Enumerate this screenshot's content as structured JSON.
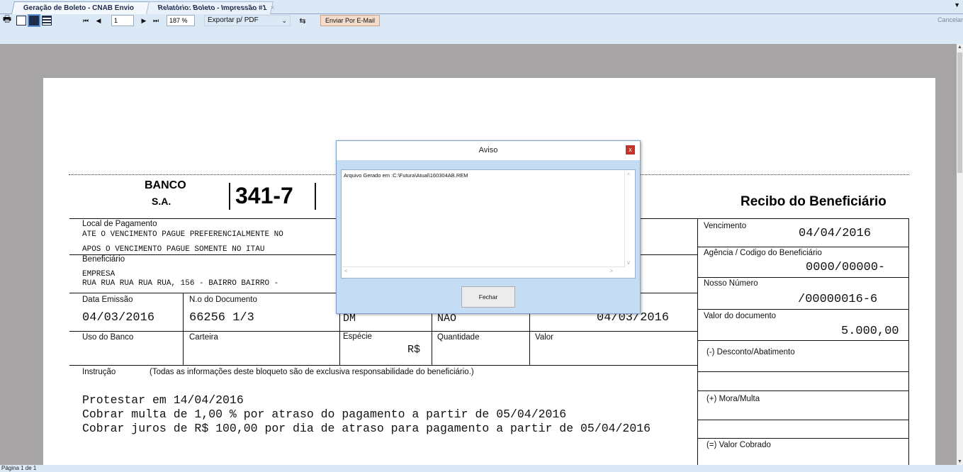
{
  "tabs": [
    {
      "label": "Geração de Boleto - CNAB Envio"
    },
    {
      "label": "Relatório: Boleto - Impressão #1",
      "close": "×"
    }
  ],
  "toolbar": {
    "page_value": "1",
    "zoom": "187 %",
    "export_selected": "Exportar p/ PDF",
    "email_button": "Enviar Por E-Mail",
    "cancel_label": "Cancelar",
    "icons": [
      "printer-icon",
      "single-page-icon",
      "double-page-icon",
      "multi-page-icon",
      "first-page-icon",
      "prev-page-icon",
      "next-page-icon",
      "last-page-icon",
      "export-icon"
    ]
  },
  "boleto": {
    "bank_name_1": "BANCO",
    "bank_name_2": "S.A.",
    "bank_code": "341-7",
    "receipt_title": "Recibo do Beneficiário",
    "local_pagamento_label": "Local de Pagamento",
    "local_line_1": "ATE O VENCIMENTO PAGUE PREFERENCIALMENTE NO",
    "local_line_2": "APOS O VENCIMENTO PAGUE SOMENTE NO ITAU",
    "beneficiario_label": "Beneficiário",
    "beneficiario_name": "EMPRESA",
    "beneficiario_address": "RUA RUA RUA RUA RUA, 156 - BAIRRO BAIRRO -",
    "data_emissao_label": "Data Emissão",
    "data_emissao": "04/03/2016",
    "num_documento_label": "N.o do Documento",
    "num_documento": "66256 1/3",
    "especie_doc": "DM",
    "aceite": "NAO",
    "data_processamento": "04/03/2016",
    "uso_banco_label": "Uso do Banco",
    "carteira_label": "Carteira",
    "especie_label": "Espécie",
    "especie_value": "R$",
    "quantidade_label": "Quantidade",
    "valor_label": "Valor",
    "instrucao_label": "Instrução",
    "instrucao_note": "(Todas as informações deste bloqueto são de exclusiva responsabilidade do beneficiário.)",
    "instructions": [
      "Protestar em 14/04/2016",
      "Cobrar multa de 1,00 % por atraso do pagamento a partir de 05/04/2016",
      "Cobrar juros de R$ 100,00 por dia de atraso para pagamento a partir de 05/04/2016"
    ],
    "vencimento_label": "Vencimento",
    "vencimento": "04/04/2016",
    "agencia_label": "Agência / Codigo do Beneficiário",
    "agencia": "0000/00000-",
    "nosso_numero_label": "Nosso Número",
    "nosso_numero": "/00000016-6",
    "valor_documento_label": "Valor do documento",
    "valor_documento": "5.000,00",
    "desconto_label": "(-) Desconto/Abatimento",
    "mora_label": "(+) Mora/Multa",
    "valor_cobrado_label": "(=) Valor Cobrado"
  },
  "dialog": {
    "title": "Aviso",
    "close": "x",
    "message": "Arquivo Gerado em :C:\\Futura\\Atual\\160304AB.REM",
    "button": "Fechar"
  },
  "status": {
    "text": "Página 1 de 1"
  }
}
